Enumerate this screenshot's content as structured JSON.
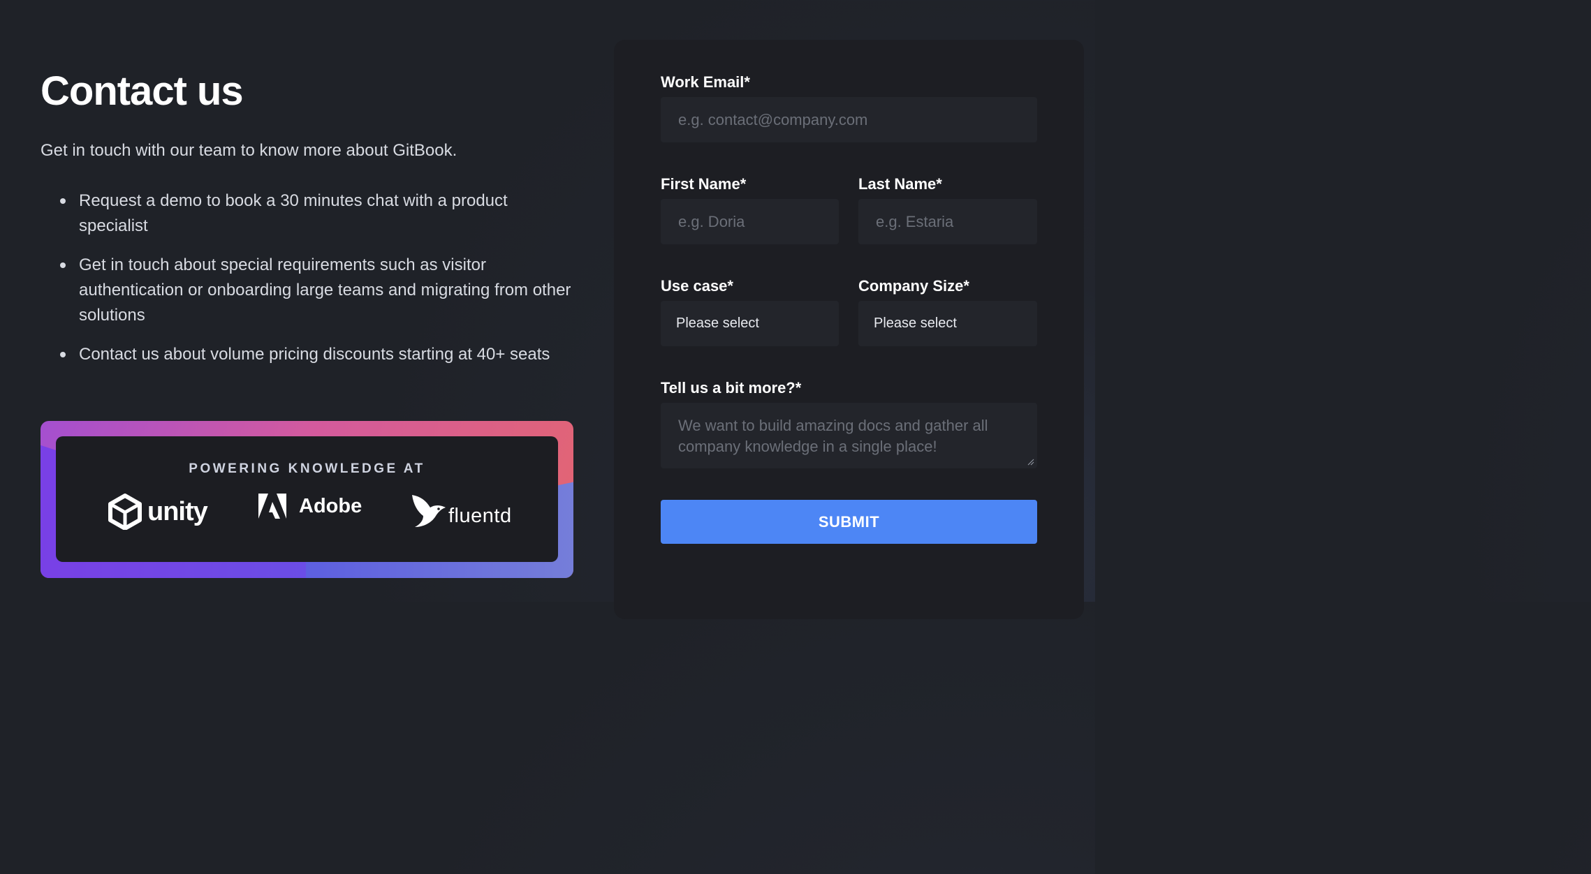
{
  "left": {
    "title": "Contact us",
    "intro": "Get in touch with our team to know more about GitBook.",
    "bullets": [
      "Request a demo to book a 30 minutes chat with a product specialist",
      "Get in touch about special requirements such as visitor authentication or onboarding large teams and migrating from other solutions",
      "Contact us about volume pricing discounts starting at 40+ seats"
    ],
    "logos": {
      "heading": "POWERING KNOWLEDGE AT",
      "unity": "unity",
      "adobe": "Adobe",
      "fluentd": "fluentd"
    }
  },
  "form": {
    "work_email": {
      "label": "Work Email*",
      "placeholder": "e.g. contact@company.com"
    },
    "first_name": {
      "label": "First Name*",
      "placeholder": "e.g. Doria"
    },
    "last_name": {
      "label": "Last Name*",
      "placeholder": "e.g. Estaria"
    },
    "use_case": {
      "label": "Use case*",
      "value": "Please select"
    },
    "company_size": {
      "label": "Company Size*",
      "value": "Please select"
    },
    "more": {
      "label": "Tell us a bit more?*",
      "placeholder": "We want to build amazing docs and gather all company knowledge in a single place!"
    },
    "submit_label": "SUBMIT"
  },
  "colors": {
    "accent": "#4d86f5",
    "card_bg": "#1d1e23",
    "field_bg": "#23252b"
  }
}
